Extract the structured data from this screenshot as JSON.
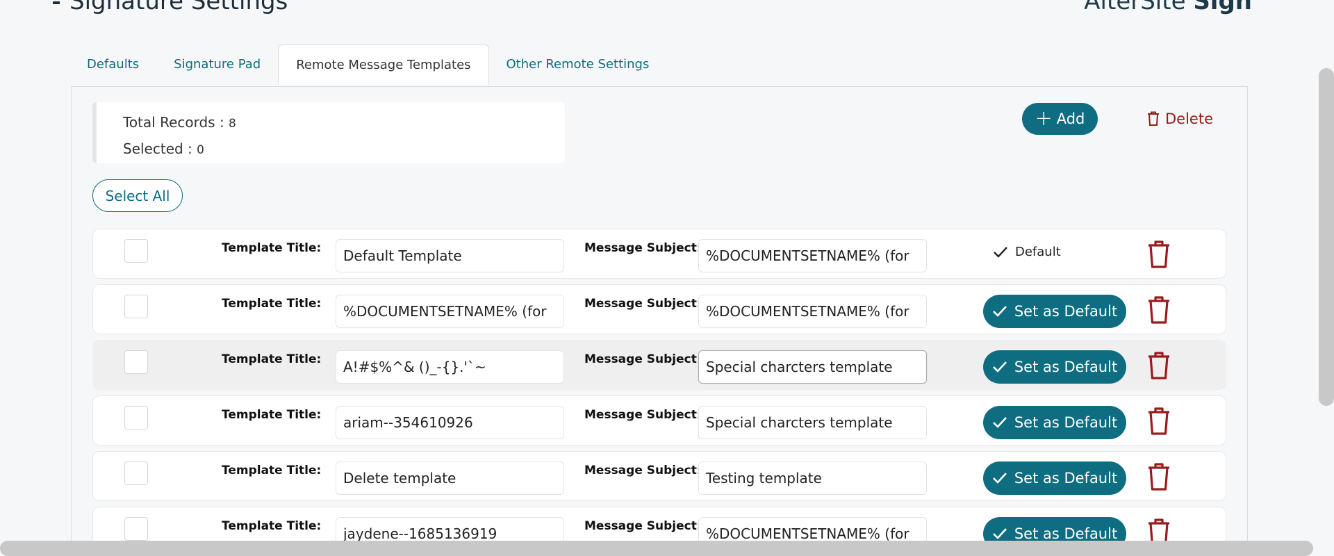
{
  "page": {
    "title": "Signature Settings",
    "brand_light": "AlterSite",
    "brand_bold": "Sign"
  },
  "tabs": [
    {
      "label": "Defaults",
      "active": false
    },
    {
      "label": "Signature Pad",
      "active": false
    },
    {
      "label": "Remote Message Templates",
      "active": true
    },
    {
      "label": "Other Remote Settings",
      "active": false
    }
  ],
  "records": {
    "total_label": "Total Records : ",
    "total_value": "8",
    "selected_label": "Selected : ",
    "selected_value": "0"
  },
  "toolbar": {
    "add_label": "Add",
    "delete_label": "Delete",
    "select_all_label": "Select All"
  },
  "labels": {
    "template_title": "Template Title:",
    "message_subject": "Message Subject:",
    "default_tag": "Default",
    "set_default": "Set as Default"
  },
  "templates": [
    {
      "title": "Default Template",
      "subject": "%DOCUMENTSETNAME% (for",
      "is_default": true
    },
    {
      "title": "%DOCUMENTSETNAME% (for",
      "subject": "%DOCUMENTSETNAME% (for",
      "is_default": false
    },
    {
      "title": "A!#$%^& ()_-{}.'`~",
      "subject": "Special charcters template",
      "is_default": false
    },
    {
      "title": "ariam--354610926",
      "subject": "Special charcters template",
      "is_default": false
    },
    {
      "title": "Delete template",
      "subject": "Testing template",
      "is_default": false
    },
    {
      "title": "jaydene--1685136919",
      "subject": "%DOCUMENTSETNAME% (for",
      "is_default": false
    }
  ],
  "colors": {
    "accent": "#0e6d80",
    "danger": "#9a1b1b"
  }
}
